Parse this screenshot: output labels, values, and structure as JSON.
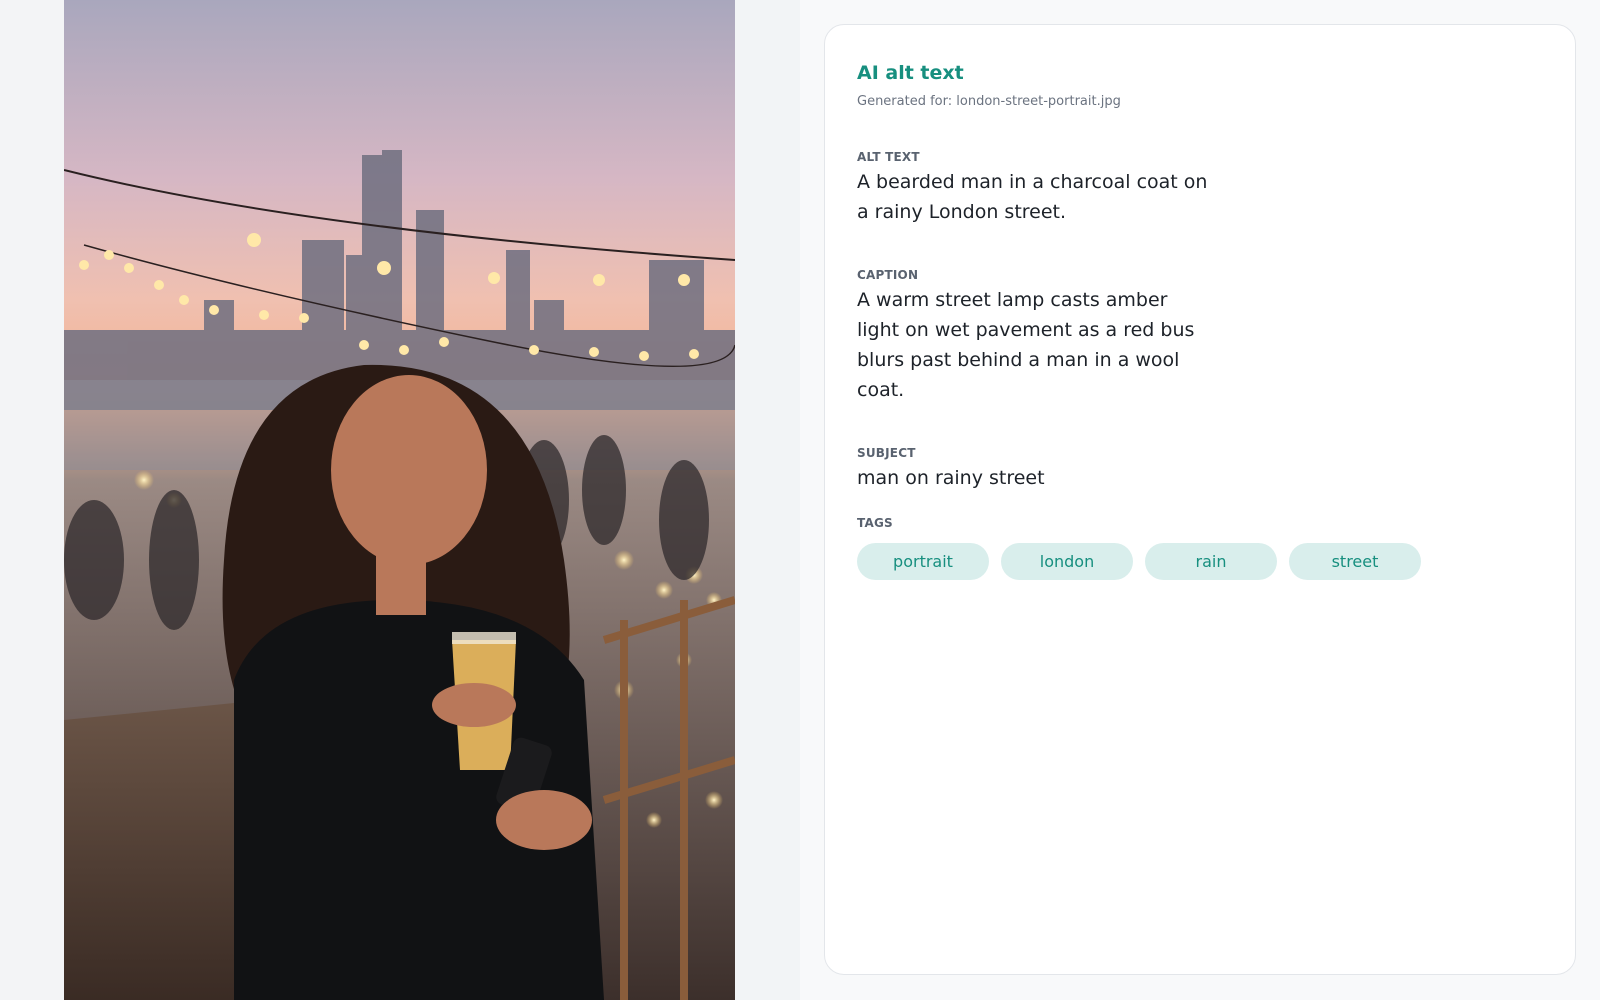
{
  "photo": {
    "alt_icon": "photo-image"
  },
  "card": {
    "title": "AI alt text",
    "generated_label": "Generated for:",
    "filename": "london-street-portrait.jpg",
    "alt_text": {
      "label": "ALT TEXT",
      "value": "A bearded man in a charcoal coat on a rainy London street."
    },
    "caption": {
      "label": "CAPTION",
      "value": "A warm street lamp casts amber light on wet pavement as a red bus blurs past behind a man in a wool coat."
    },
    "subject": {
      "label": "SUBJECT",
      "value": "man on rainy street"
    },
    "tags": {
      "label": "TAGS",
      "items": [
        "portrait",
        "london",
        "rain",
        "street"
      ]
    }
  },
  "colors": {
    "accent": "#178f7f",
    "tag_bg": "#d9eeec"
  }
}
